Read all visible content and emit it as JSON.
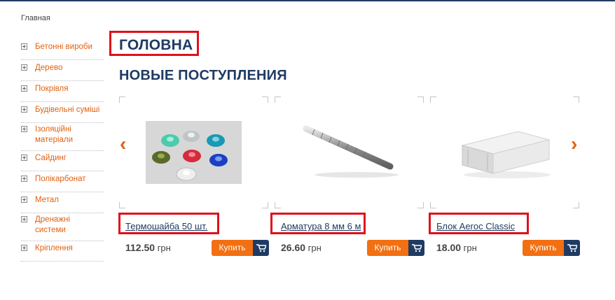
{
  "breadcrumb": "Главная",
  "sidebar": {
    "items": [
      {
        "label": "Бетонні вироби"
      },
      {
        "label": "Дерево"
      },
      {
        "label": "Покрівля"
      },
      {
        "label": "Будівельні суміші"
      },
      {
        "label": "Ізоляційні матеріали"
      },
      {
        "label": "Сайдинг"
      },
      {
        "label": "Полікарбонат"
      },
      {
        "label": "Метал"
      },
      {
        "label": "Дренажні системи"
      },
      {
        "label": "Кріплення"
      }
    ]
  },
  "page_title": "ГОЛОВНА",
  "section_title": "НОВЫЕ ПОСТУПЛЕНИЯ",
  "carousel": {
    "prev_icon": "chevron-left-icon",
    "next_icon": "chevron-right-icon"
  },
  "products": [
    {
      "name": "Термошайба 50 шт.",
      "price": "112.50",
      "currency": "грн",
      "buy_label": "Купить",
      "image": "thermo-washers"
    },
    {
      "name": "Арматура 8 мм 6 м",
      "price": "26.60",
      "currency": "грн",
      "buy_label": "Купить",
      "image": "rebar"
    },
    {
      "name": "Блок Aeroc Classic",
      "price": "18.00",
      "currency": "грн",
      "buy_label": "Купить",
      "image": "aerated-block"
    }
  ],
  "colors": {
    "accent": "#f26f12",
    "brand": "#1f3b63",
    "highlight": "#e0101b"
  }
}
